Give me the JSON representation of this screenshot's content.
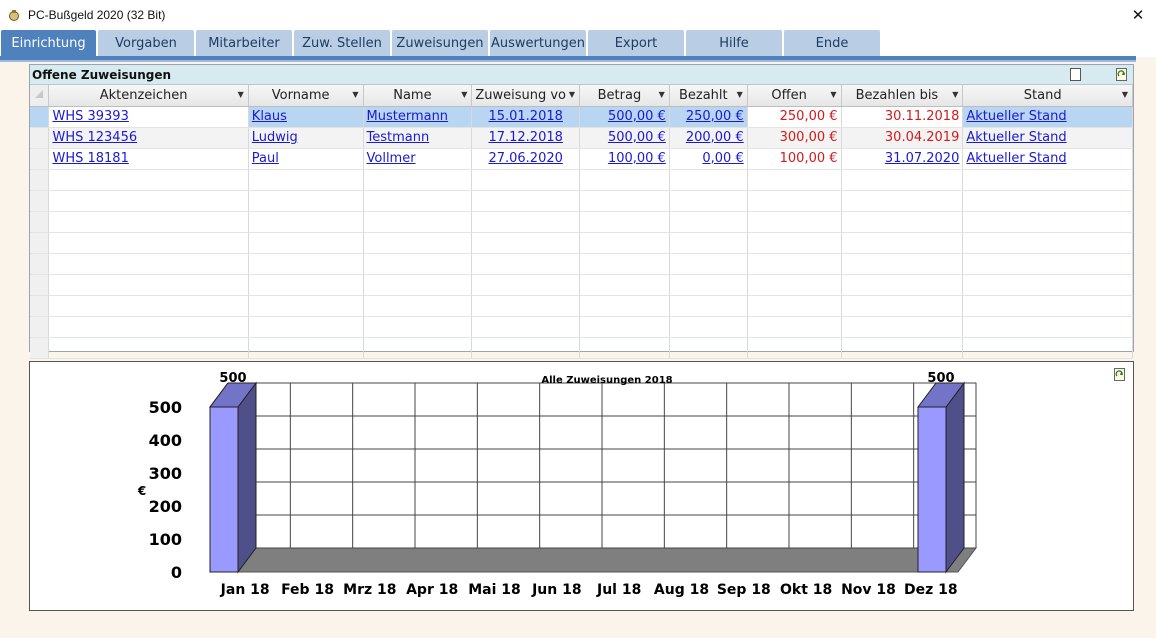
{
  "window": {
    "title": "PC-Bußgeld 2020 (32 Bit)",
    "close_glyph": "✕"
  },
  "tabs": [
    {
      "label": "Einrichtung",
      "active": true
    },
    {
      "label": "Vorgaben"
    },
    {
      "label": "Mitarbeiter"
    },
    {
      "label": "Zuw. Stellen"
    },
    {
      "label": "Zuweisungen"
    },
    {
      "label": "Auswertungen"
    },
    {
      "label": "Export"
    },
    {
      "label": "Hilfe"
    },
    {
      "label": "Ende"
    }
  ],
  "grid": {
    "title": "Offene Zuweisungen",
    "columns": [
      "Aktenzeichen",
      "Vorname",
      "Name",
      "Zuweisung vo",
      "Betrag",
      "Bezahlt",
      "Offen",
      "Bezahlen bis",
      "Stand"
    ],
    "rows": [
      {
        "aktenzeichen": "WHS 39393",
        "vorname": "Klaus",
        "name": "Mustermann",
        "zuweisung": "15.01.2018",
        "betrag": "500,00 €",
        "bezahlt": "250,00 €",
        "offen": "250,00 €",
        "bezahlen_bis": "30.11.2018",
        "stand": "Aktueller Stand"
      },
      {
        "aktenzeichen": "WHS 123456",
        "vorname": "Ludwig",
        "name": "Testmann",
        "zuweisung": "17.12.2018",
        "betrag": "500,00 €",
        "bezahlt": "200,00 €",
        "offen": "300,00 €",
        "bezahlen_bis": "30.04.2019",
        "stand": "Aktueller Stand"
      },
      {
        "aktenzeichen": "WHS 18181",
        "vorname": "Paul",
        "name": "Vollmer",
        "zuweisung": "27.06.2020",
        "betrag": "100,00 €",
        "bezahlt": "0,00 €",
        "offen": "100,00 €",
        "bezahlen_bis": "31.07.2020",
        "stand": "Aktueller Stand"
      }
    ]
  },
  "colors": {
    "accent": "#4f81bd",
    "tab_inactive": "#b9cde5",
    "bar_front": "#9999ff",
    "bar_side": "#4f4f8a",
    "link": "#1a1ad6",
    "overdue": "#d11b1b"
  },
  "chart_data": {
    "type": "bar",
    "title": "Alle Zuweisungen 2018",
    "ylabel": "€",
    "xlabel": "",
    "categories": [
      "Jan 18",
      "Feb 18",
      "Mrz 18",
      "Apr 18",
      "Mai 18",
      "Jun 18",
      "Jul 18",
      "Aug 18",
      "Sep 18",
      "Okt 18",
      "Nov 18",
      "Dez 18"
    ],
    "values": [
      500,
      0,
      0,
      0,
      0,
      0,
      0,
      0,
      0,
      0,
      0,
      500
    ],
    "data_labels": [
      "500",
      "",
      "",
      "",
      "",
      "",
      "",
      "",
      "",
      "",
      "",
      "500"
    ],
    "ylim": [
      0,
      500
    ],
    "yticks": [
      0,
      100,
      200,
      300,
      400,
      500
    ],
    "style": "3d",
    "grid": true
  }
}
